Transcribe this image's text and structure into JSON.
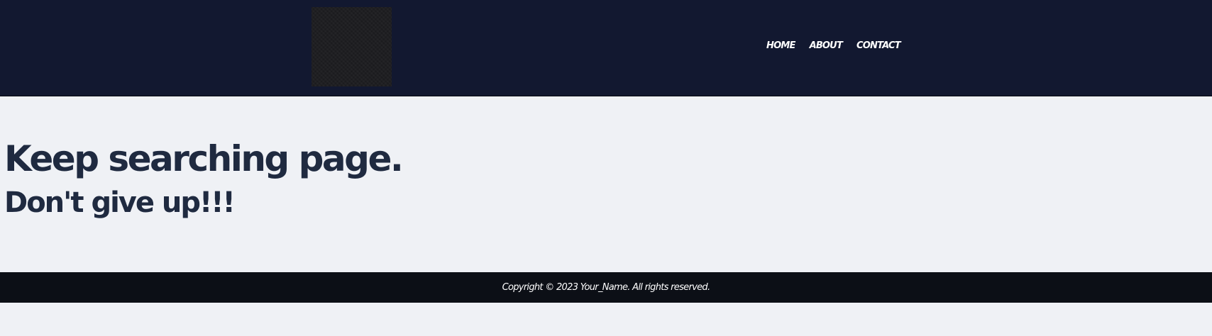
{
  "header": {
    "logo": "logo",
    "nav": [
      {
        "label": "HOME"
      },
      {
        "label": "ABOUT"
      },
      {
        "label": "CONTACT"
      }
    ]
  },
  "main": {
    "headline": "Keep searching page.",
    "subline": "Don't give up!!!"
  },
  "footer": {
    "copyright": "Copyright © 2023 Your_Name. All rights reserved."
  },
  "colors": {
    "header_bg": "#121830",
    "page_bg": "#eff1f5",
    "heading_text": "#1f2a40",
    "footer_bg": "#0c0f16",
    "footer_text": "#ffffff"
  }
}
